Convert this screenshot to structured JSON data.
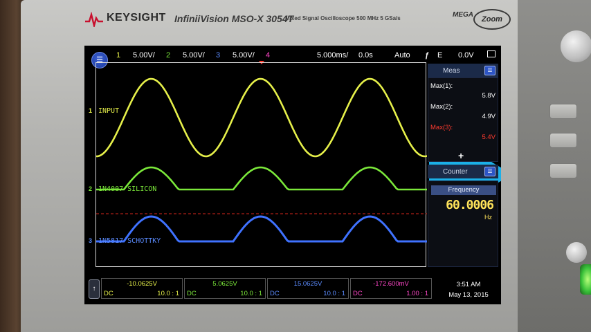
{
  "device": {
    "brand": "KEYSIGHT",
    "model": "InfiniiVision MSO-X 3054T",
    "model_subtitle": "Mixed Signal Oscilloscope   500 MHz   5 GSa/s",
    "mega": "MEGA",
    "zoom": "Zoom"
  },
  "topbar": {
    "ch1_num": "1",
    "ch1_scale": "5.00V/",
    "ch2_num": "2",
    "ch2_scale": "5.00V/",
    "ch3_num": "3",
    "ch3_scale": "5.00V/",
    "ch4_num": "4",
    "timebase": "5.000ms/",
    "delay": "0.0s",
    "trigger_mode": "Auto",
    "trigger_edge": "E",
    "trigger_level": "0.0V"
  },
  "traces": [
    {
      "name": "INPUT",
      "marker": "1",
      "color": "#e6f04a"
    },
    {
      "name": "1N4007 SILICON",
      "marker": "2",
      "color": "#7be83a"
    },
    {
      "name": "1N5817 SCHOTTKY",
      "marker": "3",
      "color": "#3f72ff"
    }
  ],
  "meas": {
    "title": "Meas",
    "rows": [
      {
        "label": "Max(1):",
        "value": "5.8V",
        "color": "#ffffff"
      },
      {
        "label": "Max(2):",
        "value": "4.9V",
        "color": "#ffffff"
      },
      {
        "label": "Max(3):",
        "value": "5.4V",
        "color": "#ff3b2f"
      }
    ],
    "add": "+"
  },
  "counter": {
    "title": "Counter",
    "tab": "Frequency",
    "value": "60.0006",
    "unit": "Hz"
  },
  "bottom": {
    "channels": [
      {
        "value": "-10.0625V",
        "coupling": "DC",
        "probe": "10.0 : 1",
        "color": "#e6f04a"
      },
      {
        "value": "5.0625V",
        "coupling": "DC",
        "probe": "10.0 : 1",
        "color": "#7be83a"
      },
      {
        "value": "15.0625V",
        "coupling": "DC",
        "probe": "10.0 : 1",
        "color": "#5b8cff"
      },
      {
        "value": "-172.600mV",
        "coupling": "DC",
        "probe": "1.00 : 1",
        "color": "#ff47c8"
      }
    ],
    "time": "3:51 AM",
    "date": "May 13, 2015"
  },
  "colors": {
    "ch1": "#e6f04a",
    "ch2": "#7be83a",
    "ch3": "#3f72ff",
    "ch4": "#ff47c8",
    "arrow": "#1bb0e8",
    "trigger_line": "#d8261b"
  }
}
